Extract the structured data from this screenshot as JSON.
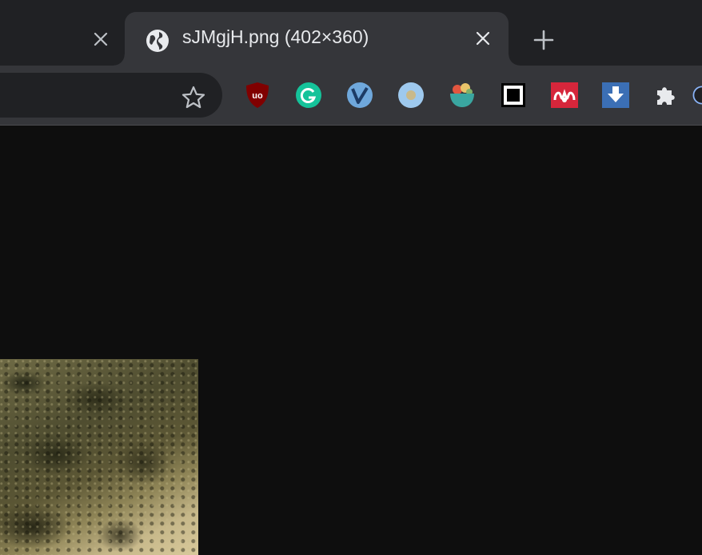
{
  "browser": {
    "tabs": [
      {
        "title": "",
        "close_icon": "close-icon"
      },
      {
        "title": "sJMgjH.png (402×360)",
        "favicon": "globe-icon",
        "close_icon": "close-icon",
        "active": true
      }
    ],
    "new_tab_icon": "plus-icon",
    "toolbar": {
      "bookmark_icon": "star-icon",
      "extensions": [
        {
          "name": "ublock-origin",
          "icon": "ublock-icon",
          "color": "#800000"
        },
        {
          "name": "grammarly",
          "icon": "grammarly-icon",
          "color": "#15c39a"
        },
        {
          "name": "vimium",
          "icon": "vimium-icon",
          "color": "#6fa8dc"
        },
        {
          "name": "circle-extension",
          "icon": "circle-icon",
          "color": "#9ec9ee"
        },
        {
          "name": "bowl-extension",
          "icon": "bowl-icon",
          "color": "#3aa6a0"
        },
        {
          "name": "square-extension",
          "icon": "square-icon",
          "color": "#ffffff"
        },
        {
          "name": "mendeley",
          "icon": "mendeley-icon",
          "color": "#d6263b"
        },
        {
          "name": "downloader",
          "icon": "download-icon",
          "color": "#3b6fb5"
        },
        {
          "name": "extensions-menu",
          "icon": "puzzle-icon",
          "color": "#e8eaed"
        }
      ]
    }
  },
  "content": {
    "image_alt": "landscape photo"
  }
}
